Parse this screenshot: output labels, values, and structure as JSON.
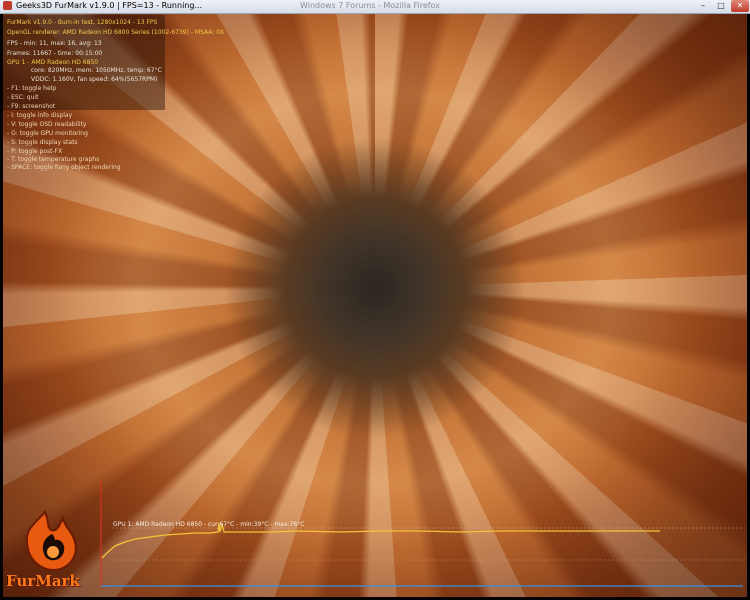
{
  "window": {
    "title": "Geeks3D FurMark v1.9.0 | FPS=13 - Running...",
    "background_title": "Windows 7 Forums - Mozilla Firefox",
    "minimize_glyph": "–",
    "maximize_glyph": "□",
    "close_glyph": "✕"
  },
  "osd": {
    "lines": [
      "FurMark v1.9.0 - Burn-in test, 1280x1024 - 13 FPS",
      "OpenGL renderer: AMD Radeon HD 6800 Series (1002-6739) - MSAA: 0X",
      "FPS - min: 11, max: 16, avg: 13",
      "Frames: 11667 - time: 00:15:00",
      "GPU 1 - AMD Radeon HD 6850",
      "core: 820MHz, mem: 1050MHz, temp: 67°C",
      "VDDC: 1.160V, fan speed: 64%(5657RPM)"
    ],
    "help": [
      "- F1: toggle help",
      "- ESC: quit",
      "- F9: screenshot",
      "- I: toggle info display",
      "- V: toggle OSD readability",
      "- G: toggle GPU monitoring",
      "- S: toggle display stats",
      "- P: toggle post-FX",
      "- T: toggle temperature graphs",
      "- SPACE: toggle furry object rendering"
    ]
  },
  "graph": {
    "label": "GPU 1: AMD Radeon HD 6850 - cur:67°C - min:39°C - max:76°C",
    "line_color": "#f5c23a",
    "axis_color": "#3a8fe0",
    "marker_color": "#e0301e"
  },
  "logo": {
    "text": "FurMark",
    "color": "#ff7a1a"
  }
}
